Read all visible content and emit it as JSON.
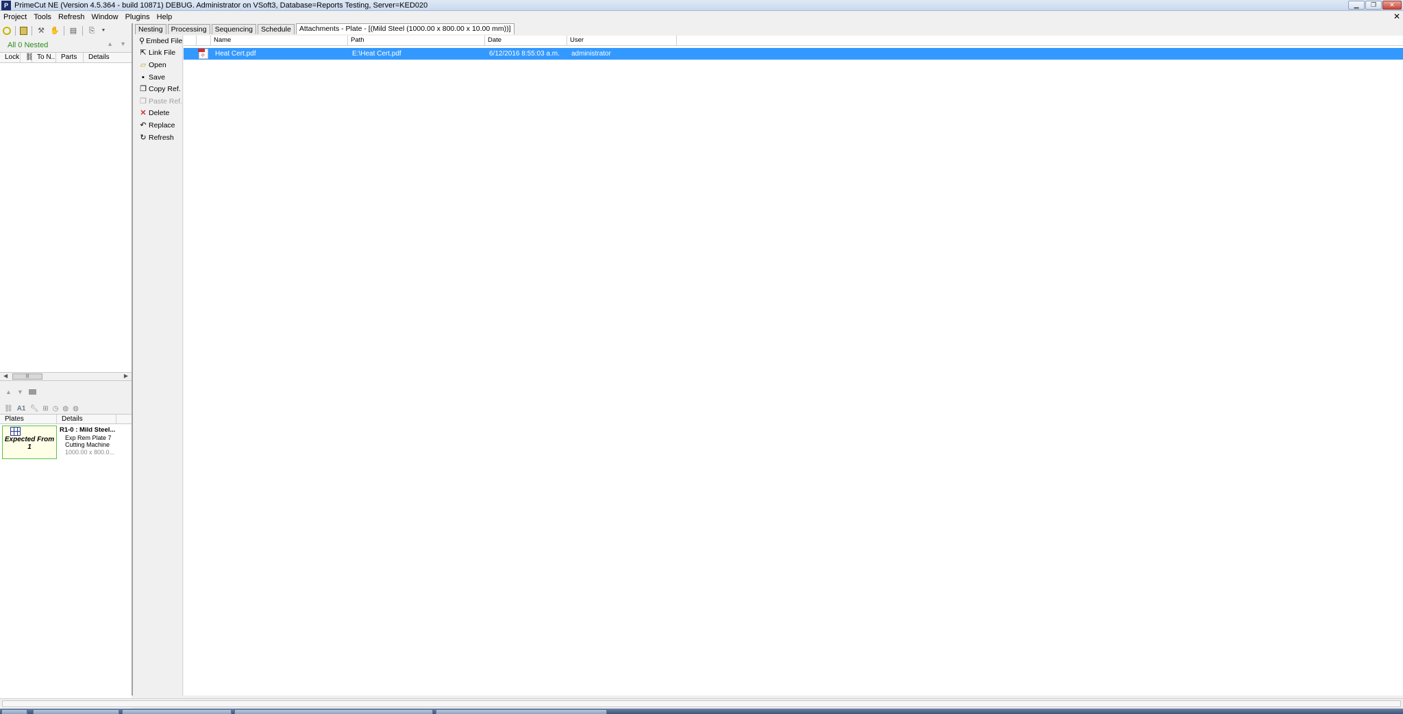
{
  "window": {
    "title": "PrimeCut NE (Version 4.5.364 - build 10871) DEBUG. Administrator on VSoft3, Database=Reports Testing, Server=KED020",
    "app_icon_label": "P"
  },
  "menu": [
    {
      "label": "Project"
    },
    {
      "label": "Tools"
    },
    {
      "label": "Refresh"
    },
    {
      "label": "Window"
    },
    {
      "label": "Plugins"
    },
    {
      "label": "Help"
    }
  ],
  "left_panel": {
    "nested_label": "All 0 Nested",
    "columns": [
      "Lock",
      "",
      "To N...",
      "Parts",
      "Details"
    ],
    "plates_columns": [
      "Plates",
      "Details"
    ],
    "plate": {
      "thumb_text": "Expected From 1",
      "title": "R1-0 : Mild Steel...",
      "line1": "Exp Rem Plate 7",
      "line2": "Cutting Machine",
      "dims": "1000.00 x 800.0..."
    }
  },
  "tabs": [
    {
      "label": "Nesting",
      "active": false
    },
    {
      "label": "Processing",
      "active": false
    },
    {
      "label": "Sequencing",
      "active": false
    },
    {
      "label": "Schedule",
      "active": false
    },
    {
      "label": "Attachments - Plate - [(Mild Steel (1000.00 x 800.00 x 10.00 mm))]",
      "active": true
    }
  ],
  "actions": [
    {
      "label": "Embed File",
      "icon": "paperclip-icon",
      "glyph": "⚲",
      "enabled": true
    },
    {
      "label": "Link File",
      "icon": "link-icon",
      "glyph": "⇱",
      "enabled": true
    },
    {
      "label": "Open",
      "icon": "folder-open-icon",
      "glyph": "▱",
      "enabled": true
    },
    {
      "label": "Save",
      "icon": "floppy-icon",
      "glyph": "▪",
      "enabled": true
    },
    {
      "label": "Copy Ref.",
      "icon": "copy-icon",
      "glyph": "❐",
      "enabled": true
    },
    {
      "label": "Paste Ref.",
      "icon": "paste-icon",
      "glyph": "❐",
      "enabled": false
    },
    {
      "label": "Delete",
      "icon": "delete-x-icon",
      "glyph": "✕",
      "enabled": true
    },
    {
      "label": "Replace",
      "icon": "replace-icon",
      "glyph": "↶",
      "enabled": true
    },
    {
      "label": "Refresh",
      "icon": "refresh-icon",
      "glyph": "↻",
      "enabled": true
    }
  ],
  "grid": {
    "columns": [
      "",
      "",
      "Name",
      "Path",
      "Date",
      "User"
    ],
    "rows": [
      {
        "name": "Heat Cert.pdf",
        "path": "E:\\Heat Cert.pdf",
        "date": "6/12/2016 8:55:03 a.m.",
        "user": "administrator",
        "selected": true
      }
    ]
  },
  "colors": {
    "selection": "#3399ff",
    "nested_green": "#2e8b1f"
  }
}
